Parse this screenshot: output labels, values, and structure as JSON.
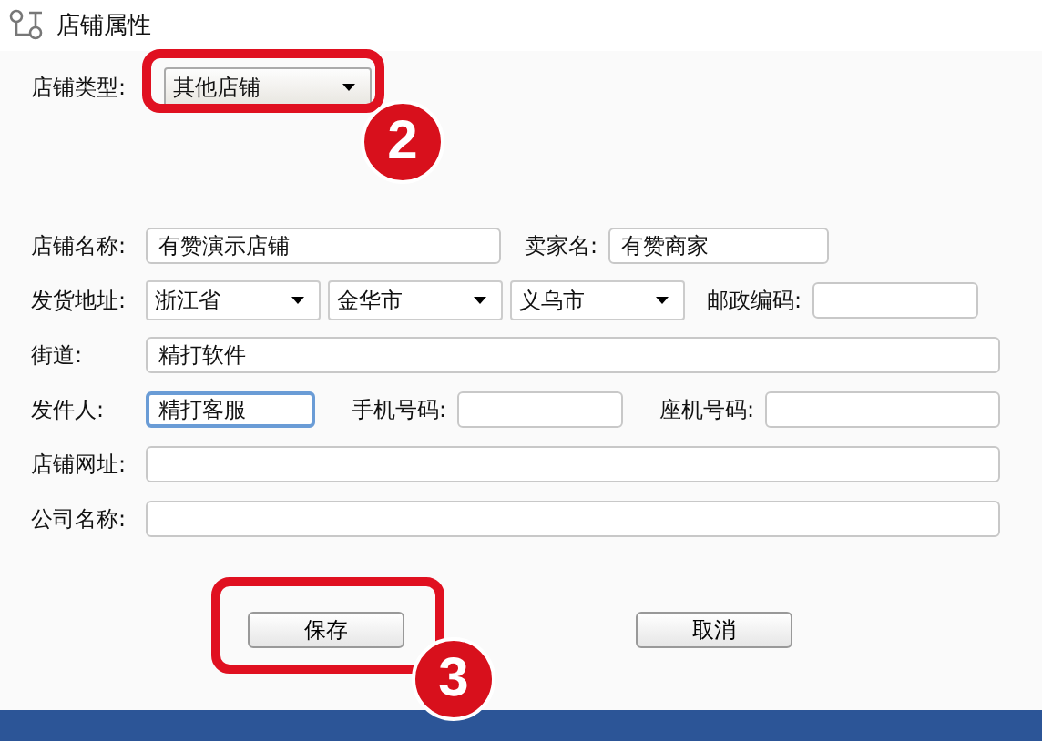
{
  "window": {
    "title": "店铺属性"
  },
  "store_type": {
    "label": "店铺类型:",
    "value": "其他店铺"
  },
  "store_name": {
    "label": "店铺名称:",
    "value": "有赞演示店铺"
  },
  "seller_name": {
    "label": "卖家名:",
    "value": "有赞商家"
  },
  "address": {
    "label": "发货地址:",
    "selects": [
      {
        "value": "浙江省"
      },
      {
        "value": "金华市"
      },
      {
        "value": "义乌市"
      }
    ]
  },
  "postcode": {
    "label": "邮政编码:"
  },
  "street": {
    "label": "街道:",
    "value": "精打软件"
  },
  "sender": {
    "label": "发件人:",
    "value": "精打客服",
    "focused": true
  },
  "mobile": {
    "label": "手机号码:"
  },
  "landline": {
    "label": "座机号码:"
  },
  "store_url": {
    "label": "店铺网址:"
  },
  "company": {
    "label": "公司名称:"
  },
  "buttons": [
    {
      "label": "保存"
    },
    {
      "label": "取消"
    }
  ],
  "callouts": [
    {
      "number": "2"
    },
    {
      "number": "3"
    }
  ]
}
